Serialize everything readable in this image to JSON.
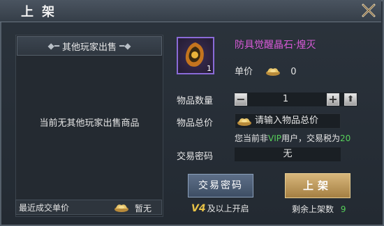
{
  "window": {
    "title": "上架"
  },
  "left_panel": {
    "header": "其他玩家出售",
    "empty_text": "当前无其他玩家出售商品",
    "recent_label": "最近成交单价",
    "recent_value": "暂无"
  },
  "item": {
    "name": "防具觉醒晶石·煌灭",
    "count": "1",
    "unit_price_label": "单价",
    "unit_price": "0"
  },
  "form": {
    "quantity_label": "物品数量",
    "quantity_value": "1",
    "minus_label": "−",
    "plus_label": "+",
    "max_label": "⬆",
    "total_label": "物品总价",
    "total_placeholder": "请输入物品总价",
    "tax_note_prefix": "您当前非",
    "tax_note_vip": "VIP",
    "tax_note_mid": "用户，交易税为",
    "tax_rate": "20",
    "password_label": "交易密码",
    "password_value": "无"
  },
  "actions": {
    "password_button": "交易密码",
    "list_button": "上架",
    "vip_badge": "V4",
    "vip_note": "及以上开启",
    "remaining_label": "剩余上架数",
    "remaining_value": "9"
  },
  "colors": {
    "item_name": "#d85ad8",
    "accent_green": "#56d05a",
    "list_button": "#c9a566"
  }
}
